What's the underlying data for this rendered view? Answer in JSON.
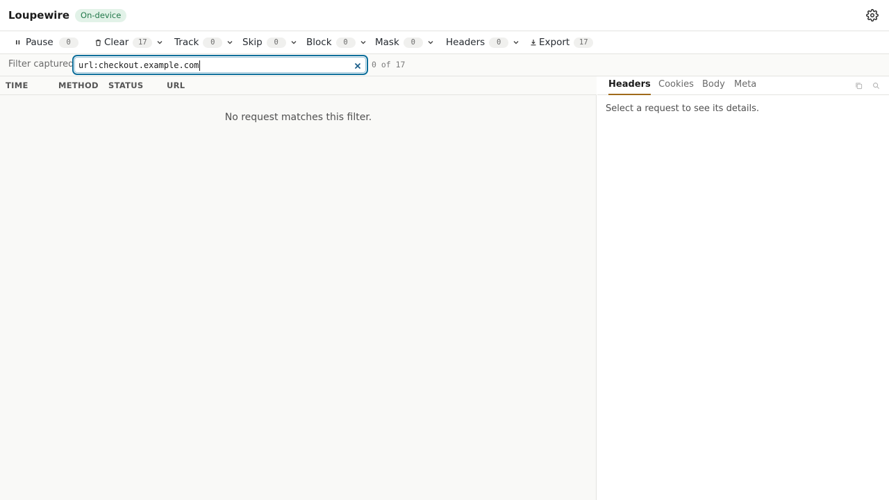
{
  "app": {
    "title": "Loupewire",
    "mode_badge": "On-device"
  },
  "toolbar": {
    "pause": {
      "label": "Pause",
      "count": "0"
    },
    "clear": {
      "label": "Clear",
      "count": "17"
    },
    "track": {
      "label": "Track",
      "count": "0"
    },
    "skip": {
      "label": "Skip",
      "count": "0"
    },
    "block": {
      "label": "Block",
      "count": "0"
    },
    "mask": {
      "label": "Mask",
      "count": "0"
    },
    "headers": {
      "label": "Headers",
      "count": "0"
    },
    "export": {
      "label": "Export",
      "count": "17"
    }
  },
  "filter": {
    "label": "Filter captured",
    "value": "url:checkout.example.com",
    "match_count": "0 of 17"
  },
  "list": {
    "columns": [
      "TIME",
      "METHOD",
      "STATUS",
      "URL"
    ],
    "empty_message": "No request matches this filter."
  },
  "detail": {
    "tabs": [
      "Headers",
      "Cookies",
      "Body",
      "Meta"
    ],
    "active_tab": "Headers",
    "empty_message": "Select a request to see its details."
  },
  "icons": {
    "settings": "gear-icon",
    "pause": "pause-icon",
    "clear": "trash-icon",
    "export": "download-icon",
    "dropdown": "chevron-down-icon",
    "clear_filter": "close-icon",
    "copy": "copy-icon",
    "search": "search-icon"
  },
  "colors": {
    "accent": "#0e6f9b",
    "badge_bg": "#e2f2e8",
    "badge_text": "#22784a",
    "active_tab_underline": "#a06a1a"
  }
}
